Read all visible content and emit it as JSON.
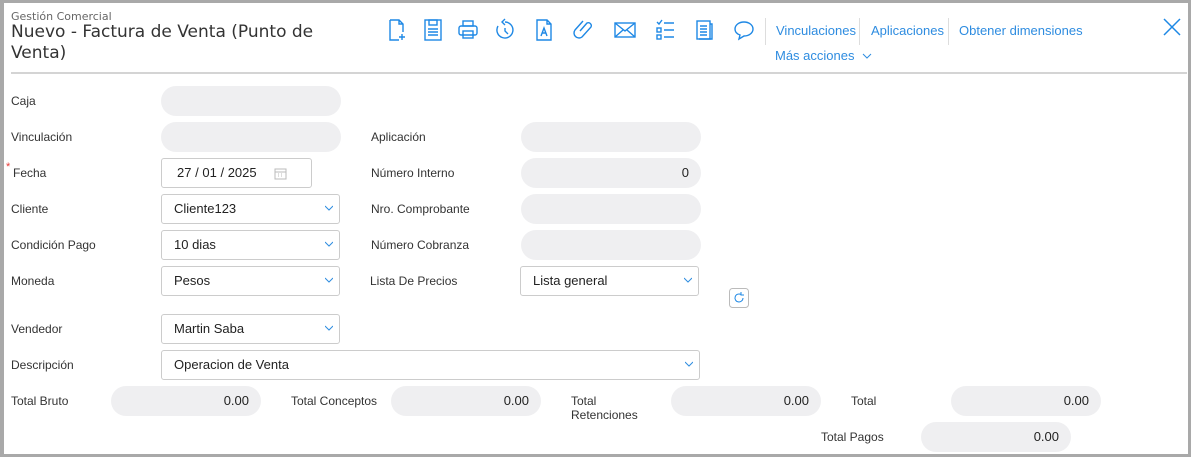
{
  "header": {
    "module": "Gestión Comercial",
    "title": "Nuevo - Factura de Venta (Punto de Venta)"
  },
  "toolbar": {
    "icons": [
      "new-document-icon",
      "save-icon",
      "print-icon",
      "history-icon",
      "text-document-icon",
      "attach-icon",
      "mail-icon",
      "checklist-icon",
      "notes-icon",
      "comment-icon"
    ],
    "links": [
      "Vinculaciones",
      "Aplicaciones",
      "Obtener dimensiones"
    ],
    "more": "Más acciones"
  },
  "form": {
    "caja": {
      "label": "Caja",
      "value": ""
    },
    "vinculacion": {
      "label": "Vinculación",
      "value": ""
    },
    "aplicacion": {
      "label": "Aplicación",
      "value": ""
    },
    "fecha": {
      "label": "Fecha",
      "required": "*",
      "day": "27",
      "month": "01",
      "year": "2025",
      "sep": "/"
    },
    "numero_interno": {
      "label": "Número Interno",
      "value": "0"
    },
    "cliente": {
      "label": "Cliente",
      "value": "Cliente123"
    },
    "nro_comprobante": {
      "label": "Nro. Comprobante",
      "value": ""
    },
    "condicion_pago": {
      "label": "Condición Pago",
      "value": "10 dias"
    },
    "numero_cobranza": {
      "label": "Número Cobranza",
      "value": ""
    },
    "moneda": {
      "label": "Moneda",
      "value": "Pesos"
    },
    "lista_precios": {
      "label": "Lista De Precios",
      "value": "Lista general"
    },
    "vendedor": {
      "label": "Vendedor",
      "value": "Martin Saba"
    },
    "descripcion": {
      "label": "Descripción",
      "value": "Operacion de Venta"
    }
  },
  "totals": {
    "bruto": {
      "label": "Total Bruto",
      "value": "0.00"
    },
    "conceptos": {
      "label": "Total Conceptos",
      "value": "0.00"
    },
    "retenciones": {
      "label": "Total Retenciones",
      "value": "0.00"
    },
    "total": {
      "label": "Total",
      "value": "0.00"
    },
    "pagos": {
      "label": "Total Pagos",
      "value": "0.00"
    }
  },
  "colors": {
    "accent": "#1e88e5",
    "field": "#efeff1"
  }
}
